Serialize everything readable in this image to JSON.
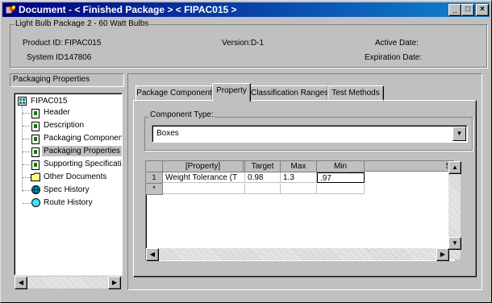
{
  "window": {
    "title": "Document - < Finished Package > < FIPAC015 >",
    "min_label": "_",
    "max_label": "□",
    "close_label": "×"
  },
  "header": {
    "group_title": "Light Bulb Package 2 - 60 Watt Bulbs",
    "product_id_label": "Product ID:",
    "product_id": "FIPAC015",
    "system_id_label": "System ID:",
    "system_id": "147806",
    "version_label": "Version:",
    "version": "D-1",
    "active_date_label": "Active Date:",
    "expiration_date_label": "Expiration Date:"
  },
  "left_panel": {
    "title": "Packaging Properties",
    "root": "FIPAC015",
    "items": [
      {
        "label": "Header",
        "icon": "document-icon"
      },
      {
        "label": "Description",
        "icon": "document-icon"
      },
      {
        "label": "Packaging Components",
        "icon": "document-icon"
      },
      {
        "label": "Packaging Properties",
        "icon": "document-icon",
        "selected": true
      },
      {
        "label": "Supporting Specifications",
        "icon": "document-icon"
      },
      {
        "label": "Other Documents",
        "icon": "folder-icon"
      },
      {
        "label": "Spec History",
        "icon": "globe-icon"
      },
      {
        "label": "Route History",
        "icon": "route-icon"
      }
    ]
  },
  "tabs": [
    {
      "label": "Package Component"
    },
    {
      "label": "Property",
      "active": true
    },
    {
      "label": "Classification Ranges"
    },
    {
      "label": "Test Methods"
    }
  ],
  "component_type": {
    "label": "Component Type:",
    "value": "Boxes"
  },
  "grid": {
    "columns": [
      "[Property]",
      "Target",
      "Max",
      "Min",
      "S"
    ],
    "rows": [
      {
        "num": "1",
        "cells": [
          "Weight Tolerance (T",
          "0.98",
          "1.3",
          ".97"
        ]
      },
      {
        "num": "*",
        "cells": [
          "",
          "",
          "",
          ""
        ]
      }
    ]
  },
  "colors": {
    "titlebar": "#000080",
    "face": "#c0c0c0"
  }
}
